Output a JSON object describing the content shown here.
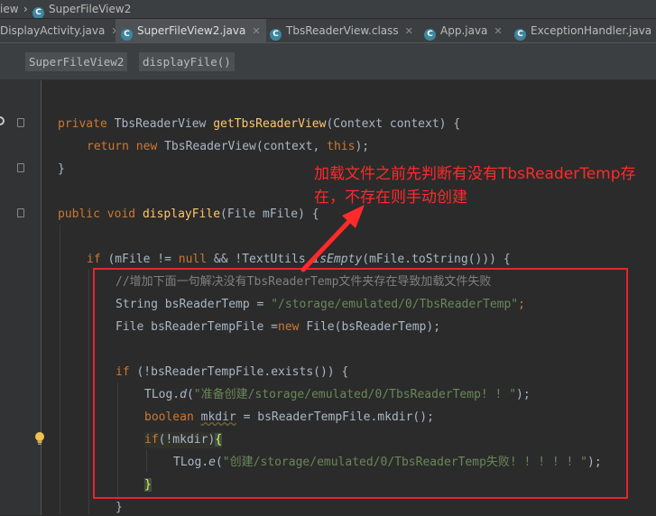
{
  "breadcrumb": {
    "prefix": "iew",
    "current": "SuperFileView2"
  },
  "tabs": [
    {
      "label": "DisplayActivity.java"
    },
    {
      "label": "SuperFileView2.java"
    },
    {
      "label": "TbsReaderView.class"
    },
    {
      "label": "App.java"
    },
    {
      "label": "ExceptionHandler.java"
    }
  ],
  "nav": {
    "class_name": "SuperFileView2",
    "method_name": "displayFile()"
  },
  "code": {
    "l1": {
      "kw": "private",
      "type": "TbsReaderView",
      "fn": "getTbsReaderView",
      "params": "(Context context) {"
    },
    "l2": {
      "kw1": "return",
      "kw2": "new",
      "rest": "TbsReaderView(context,",
      "kw3": "this",
      "end": ");"
    },
    "l3": {
      "text": "}"
    },
    "l4": {
      "kw1": "public",
      "kw2": "void",
      "fn": "displayFile",
      "params": "(File mFile)",
      "brace": "{"
    },
    "l5": {
      "kw1": "if",
      "a": "(mFile !=",
      "kw2": "null",
      "b": "&& !TextUtils.",
      "method": "isEmpty",
      "c": "(mFile.toString())) {"
    },
    "l6": {
      "comment": "//增加下面一句解决没有TbsReaderTemp文件夹存在导致加载文件失败"
    },
    "l7": {
      "a": "String bsReaderTemp =",
      "str": "\"/storage/emulated/0/TbsReaderTemp\"",
      "b": ";"
    },
    "l8": {
      "a": "File bsReaderTempFile =",
      "kw": "new",
      "b": "File(bsReaderTemp);"
    },
    "l9": {
      "kw": "if",
      "a": "(!bsReaderTempFile.exists()) {"
    },
    "l10": {
      "a": "TLog.",
      "method": "d",
      "b": "(",
      "str": "\"准备创建/storage/emulated/0/TbsReaderTemp! ! \"",
      "c": ");"
    },
    "l11": {
      "kw": "boolean",
      "var": "mkdir",
      "a": "= bsReaderTempFile.mkdir();"
    },
    "l12": {
      "kw": "if",
      "a": "(!mkdir)",
      "brace": "{"
    },
    "l13": {
      "a": "TLog.",
      "method": "e",
      "b": "(",
      "str": "\"创建/storage/emulated/0/TbsReaderTemp失败! ! ! ! ! \"",
      "c": ");"
    },
    "l14": {
      "text": "}"
    },
    "l15": {
      "text": "}"
    }
  },
  "annotation": {
    "text": "加载文件之前先判断有没有TbsReaderTemp存在，不存在则手动创建",
    "color": "#ff2a2a"
  }
}
